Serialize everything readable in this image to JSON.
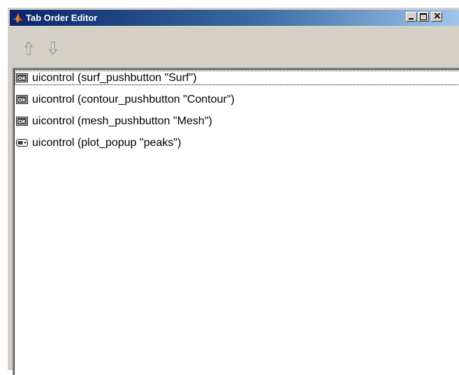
{
  "window": {
    "title": "Tab Order Editor",
    "colors": {
      "titlebar_start": "#0a246a",
      "titlebar_end": "#a6caf0",
      "face": "#d4d0c8"
    }
  },
  "titlebar": {
    "app_icon": "matlab-icon",
    "buttons": [
      {
        "name": "minimize-icon"
      },
      {
        "name": "maximize-icon"
      },
      {
        "name": "close-icon",
        "glyph": "×"
      }
    ]
  },
  "toolbar": {
    "buttons": [
      {
        "name": "move-up-icon"
      },
      {
        "name": "move-down-icon"
      }
    ]
  },
  "list": {
    "items": [
      {
        "label": "uicontrol (surf_pushbutton \"Surf\")",
        "icon": "pushbutton-icon",
        "selected": true
      },
      {
        "label": "uicontrol (contour_pushbutton \"Contour\")",
        "icon": "pushbutton-icon",
        "selected": false
      },
      {
        "label": "uicontrol (mesh_pushbutton \"Mesh\")",
        "icon": "pushbutton-icon",
        "selected": false
      },
      {
        "label": "uicontrol (plot_popup \"peaks\")",
        "icon": "popupmenu-icon",
        "selected": false
      }
    ]
  }
}
